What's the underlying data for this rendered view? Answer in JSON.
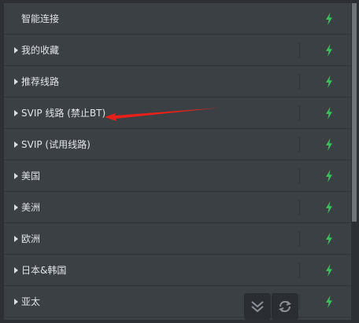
{
  "rows": [
    {
      "label": "智能连接",
      "has_caret": false
    },
    {
      "label": "我的收藏",
      "has_caret": true
    },
    {
      "label": "推荐线路",
      "has_caret": true
    },
    {
      "label": "SVIP 线路 (禁止BT)",
      "has_caret": true
    },
    {
      "label": "SVIP (试用线路)",
      "has_caret": true
    },
    {
      "label": "美国",
      "has_caret": true
    },
    {
      "label": "美洲",
      "has_caret": true
    },
    {
      "label": "欧洲",
      "has_caret": true
    },
    {
      "label": "日本&韩国",
      "has_caret": true
    },
    {
      "label": "亚太",
      "has_caret": true
    }
  ],
  "icons": {
    "row_action": "lightning-bolt-icon",
    "expand": "double-chevron-down-icon",
    "refresh": "refresh-icon",
    "row_caret": "caret-right-icon",
    "annotation": "red-arrow"
  },
  "colors": {
    "background": "#2c3034",
    "list_background": "#3b4045",
    "text": "#e2e5e8",
    "bolt": "#3fbf5a",
    "annotation_arrow": "#e8201a"
  }
}
